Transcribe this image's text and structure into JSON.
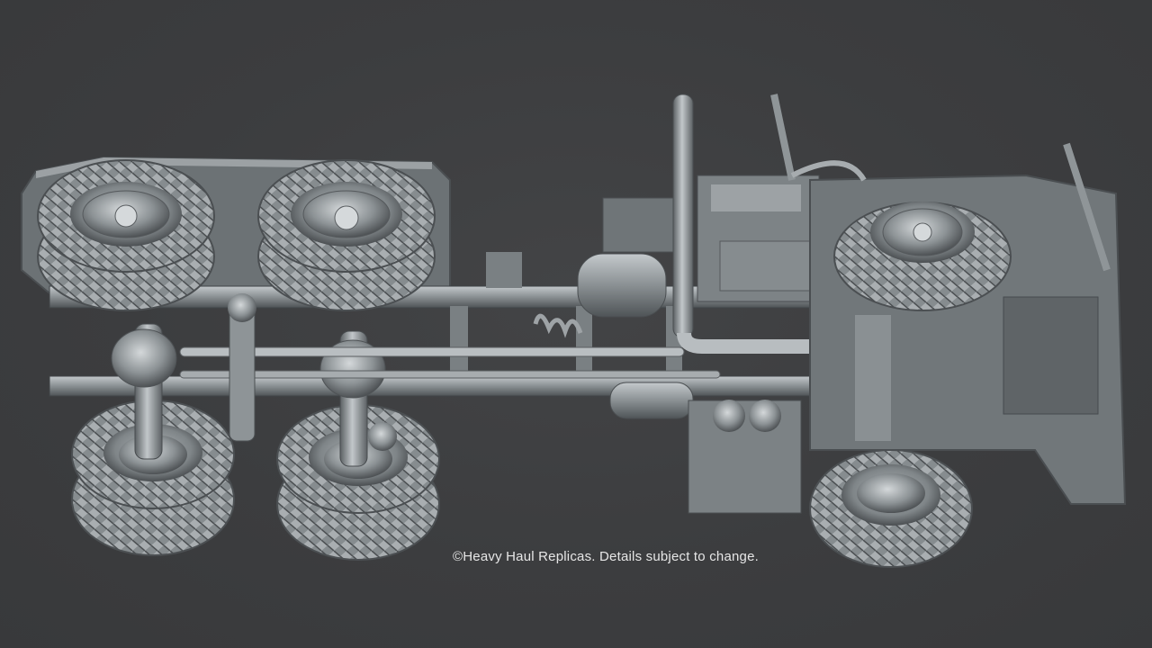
{
  "caption": "©Heavy Haul Replicas. Details subject to change.",
  "colors": {
    "background": "#3c3d3f",
    "model_base": "#7c8285",
    "model_light": "#c9ced1",
    "model_dark": "#2e3133",
    "caption_text": "#e6e6e6"
  }
}
